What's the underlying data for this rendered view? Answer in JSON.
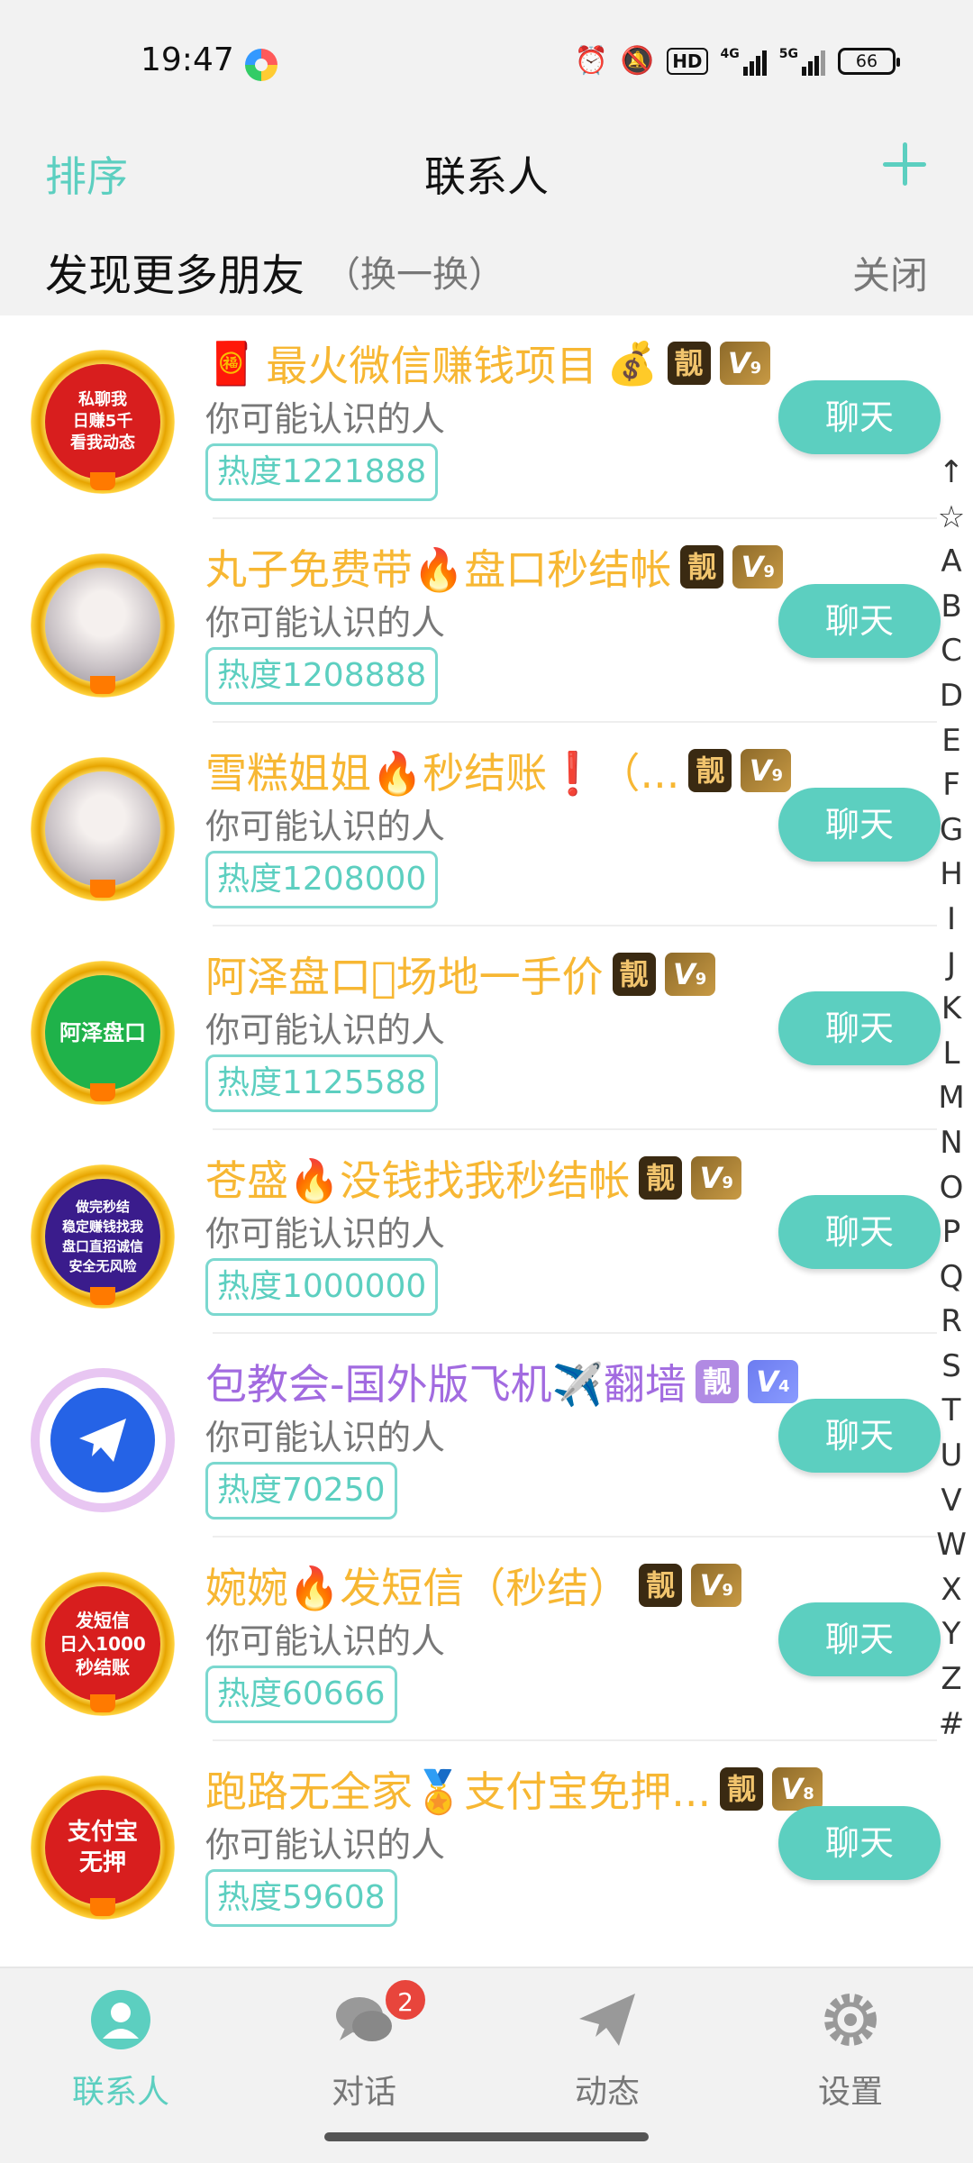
{
  "status_bar": {
    "time": "19:47",
    "hd_label": "HD",
    "net1": "4G",
    "net2": "5G",
    "battery": "66"
  },
  "header": {
    "sort_label": "排序",
    "title": "联系人",
    "add_icon": "plus-icon"
  },
  "discover": {
    "title": "发现更多朋友",
    "refresh_label": "（换一换）",
    "close_label": "关闭"
  },
  "contacts": [
    {
      "name": "最火微信赚钱项目",
      "badge1": "靓",
      "vip_level": "9",
      "subtitle": "你可能认识的人",
      "heat": "热度1221888",
      "button": "聊天",
      "avatar_text": "私聊我\n日赚5千\n看我动态"
    },
    {
      "name": "丸子免费带🔥盘口秒结帐",
      "badge1": "靓",
      "vip_level": "9",
      "subtitle": "你可能认识的人",
      "heat": "热度1208888",
      "button": "聊天"
    },
    {
      "name": "雪糕姐姐🔥秒结账❗（...",
      "badge1": "靓",
      "vip_level": "9",
      "subtitle": "你可能认识的人",
      "heat": "热度1208000",
      "button": "聊天"
    },
    {
      "name": "阿泽盘口\u0000场地一手价",
      "badge1": "靓",
      "vip_level": "9",
      "subtitle": "你可能认识的人",
      "heat": "热度1125588",
      "button": "聊天",
      "avatar_text": "阿泽盘口"
    },
    {
      "name": "苍盛🔥没钱找我秒结帐",
      "badge1": "靓",
      "vip_level": "9",
      "subtitle": "你可能认识的人",
      "heat": "热度1000000",
      "button": "聊天",
      "avatar_text": "做完秒结\n稳定赚钱找我\n盘口直招诚信\n安全无风险"
    },
    {
      "name": "包教会-国外版飞机✈️翻墙",
      "badge1": "靓",
      "vip_level": "4",
      "subtitle": "你可能认识的人",
      "heat": "热度70250",
      "button": "聊天"
    },
    {
      "name": "婉婉🔥发短信（秒结）",
      "badge1": "靓",
      "vip_level": "9",
      "subtitle": "你可能认识的人",
      "heat": "热度60666",
      "button": "聊天",
      "avatar_text": "发短信\n日入1000\n秒结账"
    },
    {
      "name": "跑路无全家🏅支付宝免押...",
      "badge1": "靓",
      "vip_level": "8",
      "subtitle": "你可能认识的人",
      "heat": "热度59608",
      "button": "聊天",
      "avatar_text": "支付宝\n无押"
    }
  ],
  "index_bar": [
    "↑",
    "☆",
    "A",
    "B",
    "C",
    "D",
    "E",
    "F",
    "G",
    "H",
    "I",
    "J",
    "K",
    "L",
    "M",
    "N",
    "O",
    "P",
    "Q",
    "R",
    "S",
    "T",
    "U",
    "V",
    "W",
    "X",
    "Y",
    "Z",
    "#"
  ],
  "bottom_nav": [
    {
      "label": "联系人",
      "icon": "contact-icon",
      "active": true
    },
    {
      "label": "对话",
      "icon": "chat-bubble-icon",
      "badge": "2"
    },
    {
      "label": "动态",
      "icon": "paper-plane-icon"
    },
    {
      "label": "设置",
      "icon": "gear-icon"
    }
  ],
  "colors": {
    "accent": "#5ccfc0",
    "gold_name": "#f7b733",
    "purple_name": "#a26be0",
    "badge_red": "#e8453c"
  }
}
